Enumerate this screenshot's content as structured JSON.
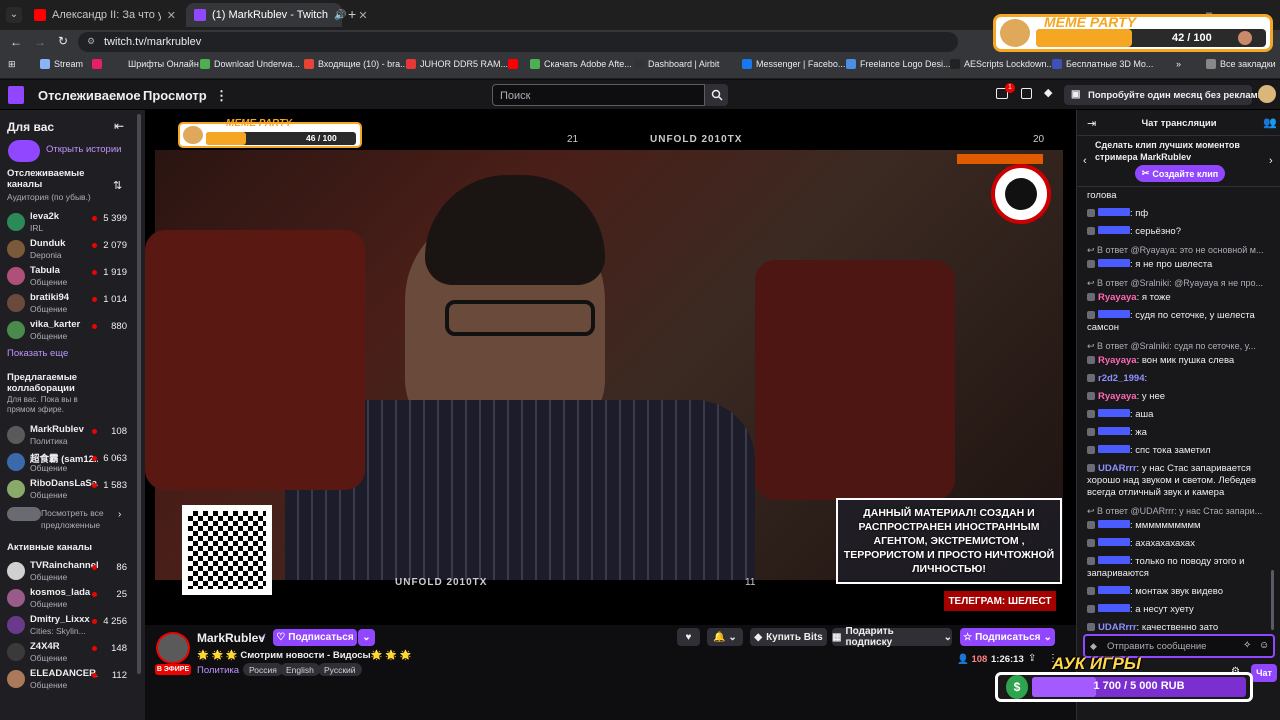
{
  "browser": {
    "tabs": [
      {
        "title": "Александр II: За что убили им",
        "active": false
      },
      {
        "title": "(1) MarkRublev - Twitch",
        "active": true
      }
    ],
    "url": "twitch.tv/markrublev",
    "bookmarks": [
      "Stream",
      "Шрифты Онлайн",
      "Download Underwa...",
      "Входящие (10) - bra...",
      "JUHOR DDR5 RAM...",
      "Скачать Adobe Afte...",
      "Dashboard | Airbit",
      "Messenger | Facebo...",
      "Freelance Logo Desi...",
      "AEScripts Lockdown...",
      "Бесплатные 3D Mo...",
      "Все закладки"
    ]
  },
  "twitch": {
    "nav": {
      "following": "Отслеживаемое",
      "browse": "Просмотр",
      "search_placeholder": "Поиск",
      "notif_count": "1",
      "promo": "Попробуйте один месяц без рекламы"
    },
    "sidebar": {
      "for_you": "Для вас",
      "open_stories": "Открыть истории",
      "followed_title": "Отслеживаемые каналы",
      "followed_sub": "Аудитория (по убыв.)",
      "followed": [
        {
          "name": "leva2k",
          "cat": "IRL",
          "viewers": "5 399",
          "color": "#2b8a57"
        },
        {
          "name": "Dunduk",
          "cat": "Deponia",
          "viewers": "2 079",
          "color": "#7a5a3a"
        },
        {
          "name": "Tabula",
          "cat": "Общение",
          "viewers": "1 919",
          "color": "#b0507a"
        },
        {
          "name": "bratiki94",
          "cat": "Общение",
          "viewers": "1 014",
          "color": "#6a4a3a"
        },
        {
          "name": "vika_karter",
          "cat": "Общение",
          "viewers": "880",
          "color": "#4a8a4a"
        }
      ],
      "show_more": "Показать еще",
      "suggested_title": "Предлагаемые коллаборации",
      "suggested_sub": "Для вас. Пока вы в прямом эфире.",
      "suggested": [
        {
          "name": "MarkRublev",
          "cat": "Политика",
          "viewers": "108",
          "color": "#5a5a5a"
        },
        {
          "name": "超食霸 (sam12...",
          "cat": "Общение",
          "viewers": "6 063",
          "color": "#3a6aaa"
        },
        {
          "name": "RiboDansLaSa...",
          "cat": "Общение",
          "viewers": "1 583",
          "color": "#8aaa6a"
        }
      ],
      "see_all": "Посмотреть все предложенные",
      "active_title": "Активные каналы",
      "active": [
        {
          "name": "TVRainchannel",
          "cat": "Общение",
          "viewers": "86",
          "color": "#d0d0d0"
        },
        {
          "name": "kosmos_lada",
          "cat": "Общение",
          "viewers": "25",
          "color": "#9a5a8a"
        },
        {
          "name": "Dmitry_Lixxx",
          "cat": "Cities: Skylin...",
          "viewers": "4 256",
          "color": "#6a3a8a"
        },
        {
          "name": "Z4X4R",
          "cat": "Общение",
          "viewers": "148",
          "color": "#3a3a3a"
        },
        {
          "name": "ELEADANCER_",
          "cat": "Общение",
          "viewers": "112",
          "color": "#aa7a5a"
        }
      ]
    },
    "player": {
      "meme_small_title": "MEME PARTY",
      "meme_small_progress": "46 / 100",
      "top_left": "21",
      "top_center": "UNFOLD 2010TX",
      "top_right": "20",
      "bottom_center": "UNFOLD 2010TX",
      "bottom_right": "11",
      "bottom_left": "4",
      "disclaimer": "ДАННЫЙ МАТЕРИАЛ! СОЗДАН И РАСПРОСТРАНЕН ИНОСТРАННЫМ АГЕНТОМ, ЭКСТРЕМИСТОМ , ТЕРРОРИСТОМ И ПРОСТО НИЧТОЖНОЙ ЛИЧНОСТЬЮ!",
      "telegram": "ТЕЛЕГРАМ: ШЕЛЕСТ"
    },
    "channel": {
      "name": "MarkRublev",
      "follow": "Подписаться",
      "title": "🌟 🌟 🌟 Смотрим новости - Видосы🌟 🌟 🌟",
      "live": "В ЭФИРЕ",
      "category": "Политика",
      "tags": [
        "Россия",
        "English",
        "Русский"
      ],
      "buy_bits": "Купить Bits",
      "gift": "Подарить подписку",
      "subscribe": "Подписаться",
      "viewers": "108",
      "uptime": "1:26:13"
    },
    "chat": {
      "title": "Чат трансляции",
      "clip_text": "Сделать клип лучших моментов стримера MarkRublev",
      "clip_btn": "Создайте клип",
      "messages": [
        {
          "user": "",
          "text": "голова"
        },
        {
          "user": "user",
          "text": ": пф"
        },
        {
          "user": "user",
          "text": ": серьёзно?"
        },
        {
          "reply": "В ответ @Ryayaya: это не основной м..."
        },
        {
          "user": "user",
          "text": ": я не про шелеста"
        },
        {
          "reply": "В ответ @Sralniki: @Ryayaya я не про..."
        },
        {
          "user": "Ryayaya",
          "text": ": я тоже",
          "color": "#ff69b4"
        },
        {
          "user": "user",
          "text": ": судя по сеточке, у шелеста самсон"
        },
        {
          "reply": "В ответ @Sralniki: судя по сеточке, у..."
        },
        {
          "user": "Ryayaya",
          "text": ": вон мик пушка слева",
          "color": "#ff69b4"
        },
        {
          "user": "r2d2_1994",
          "text": ":",
          "color": "#8f8fff"
        },
        {
          "user": "Ryayaya",
          "text": ": у нее",
          "color": "#ff69b4"
        },
        {
          "user": "user",
          "text": ": аша"
        },
        {
          "user": "user",
          "text": ": жа"
        },
        {
          "user": "user",
          "text": ": спс тока заметил"
        },
        {
          "user": "UDARrrr",
          "text": ": у нас Стас запаривается хорошо над звуком и светом. Лебедев всегда отличный звук и камера",
          "color": "#8f8fff"
        },
        {
          "reply": "В ответ @UDARrrr: у нас Стас запари..."
        },
        {
          "user": "user",
          "text": ": мммммммммм"
        },
        {
          "user": "user",
          "text": ": ахахахахахах"
        },
        {
          "user": "user",
          "text": ": только по поводу этого и запариваются"
        },
        {
          "user": "user",
          "text": ": монтаж звук видево"
        },
        {
          "user": "user",
          "text": ": а несут хуету"
        },
        {
          "user": "UDARrrr",
          "text": ": качественно зато",
          "color": "#8f8fff"
        }
      ],
      "input_placeholder": "Отправить сообщение",
      "send": "Чат"
    }
  },
  "overlays": {
    "meme_title": "MEME PARTY",
    "meme_progress": "42 / 100",
    "auction_title": "АУК ИГРЫ",
    "auction_progress": "1 700 / 5 000 RUB"
  }
}
